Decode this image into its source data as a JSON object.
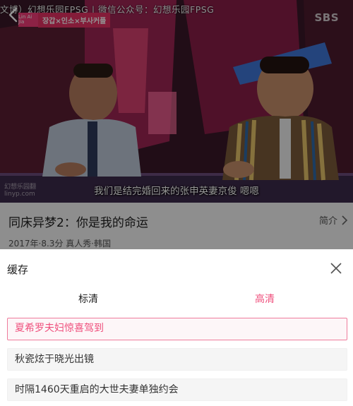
{
  "video": {
    "watermark": "文博）幻想乐园FPSG | 微信公众号：幻想乐园FPSG",
    "logo_mini": "Lin Ai Jia",
    "show_logo": "장갑×인소×부사커플",
    "channel": "SBS",
    "site_mark": "幻想乐园翻\nlinyp.com",
    "subtitle": "我们是结完婚回来的张申英妻京俊 嗯嗯"
  },
  "info": {
    "title": "同床异梦2：你是我的命运",
    "meta": "2017年·8.3分 真人秀·韩国",
    "intro_label": "简介"
  },
  "sheet": {
    "title": "缓存",
    "tabs": [
      {
        "label": "标清",
        "selected": false
      },
      {
        "label": "高清",
        "selected": true
      }
    ],
    "episodes": [
      {
        "label": "夏希罗夫妇惊喜驾到",
        "selected": true
      },
      {
        "label": "秋瓷炫于晓光出镜",
        "selected": false
      },
      {
        "label": "时隔1460天重启的大世夫妻单独约会",
        "selected": false
      }
    ]
  },
  "colors": {
    "accent": "#ef4f7c",
    "accent_border": "#ef7c9c",
    "show_logo": "#e33163"
  },
  "icons": {
    "back": "chevron-left-icon",
    "intro": "chevron-right-icon",
    "close": "close-icon"
  }
}
